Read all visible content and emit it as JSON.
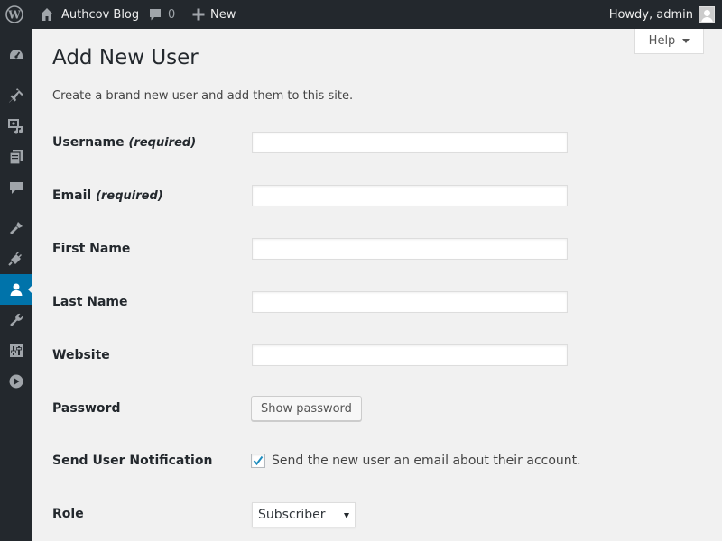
{
  "adminbar": {
    "site_name": "Authcov Blog",
    "comments_count": "0",
    "new_label": "New",
    "account_greeting": "Howdy, admin"
  },
  "sidebar": {
    "icons": [
      "dashboard-icon",
      "posts-icon",
      "media-icon",
      "pages-icon",
      "comments-icon",
      "appearance-icon",
      "plugins-icon",
      "users-icon",
      "tools-icon",
      "settings-icon",
      "media-player-icon"
    ],
    "current": "users-icon"
  },
  "help_tab": {
    "label": "Help"
  },
  "page": {
    "title": "Add New User",
    "intro": "Create a brand new user and add them to this site."
  },
  "form": {
    "required_note": "(required)",
    "username_label": "Username",
    "email_label": "Email",
    "first_name_label": "First Name",
    "last_name_label": "Last Name",
    "website_label": "Website",
    "password_label": "Password",
    "show_password_button": "Show password",
    "notification_label": "Send User Notification",
    "notification_text": "Send the new user an email about their account.",
    "notification_checked": true,
    "role_label": "Role",
    "role_value": "Subscriber"
  },
  "colors": {
    "adminbar_bg": "#23282d",
    "menu_current": "#0073aa",
    "page_bg": "#f1f1f1",
    "checkmark": "#1e8cbe"
  }
}
